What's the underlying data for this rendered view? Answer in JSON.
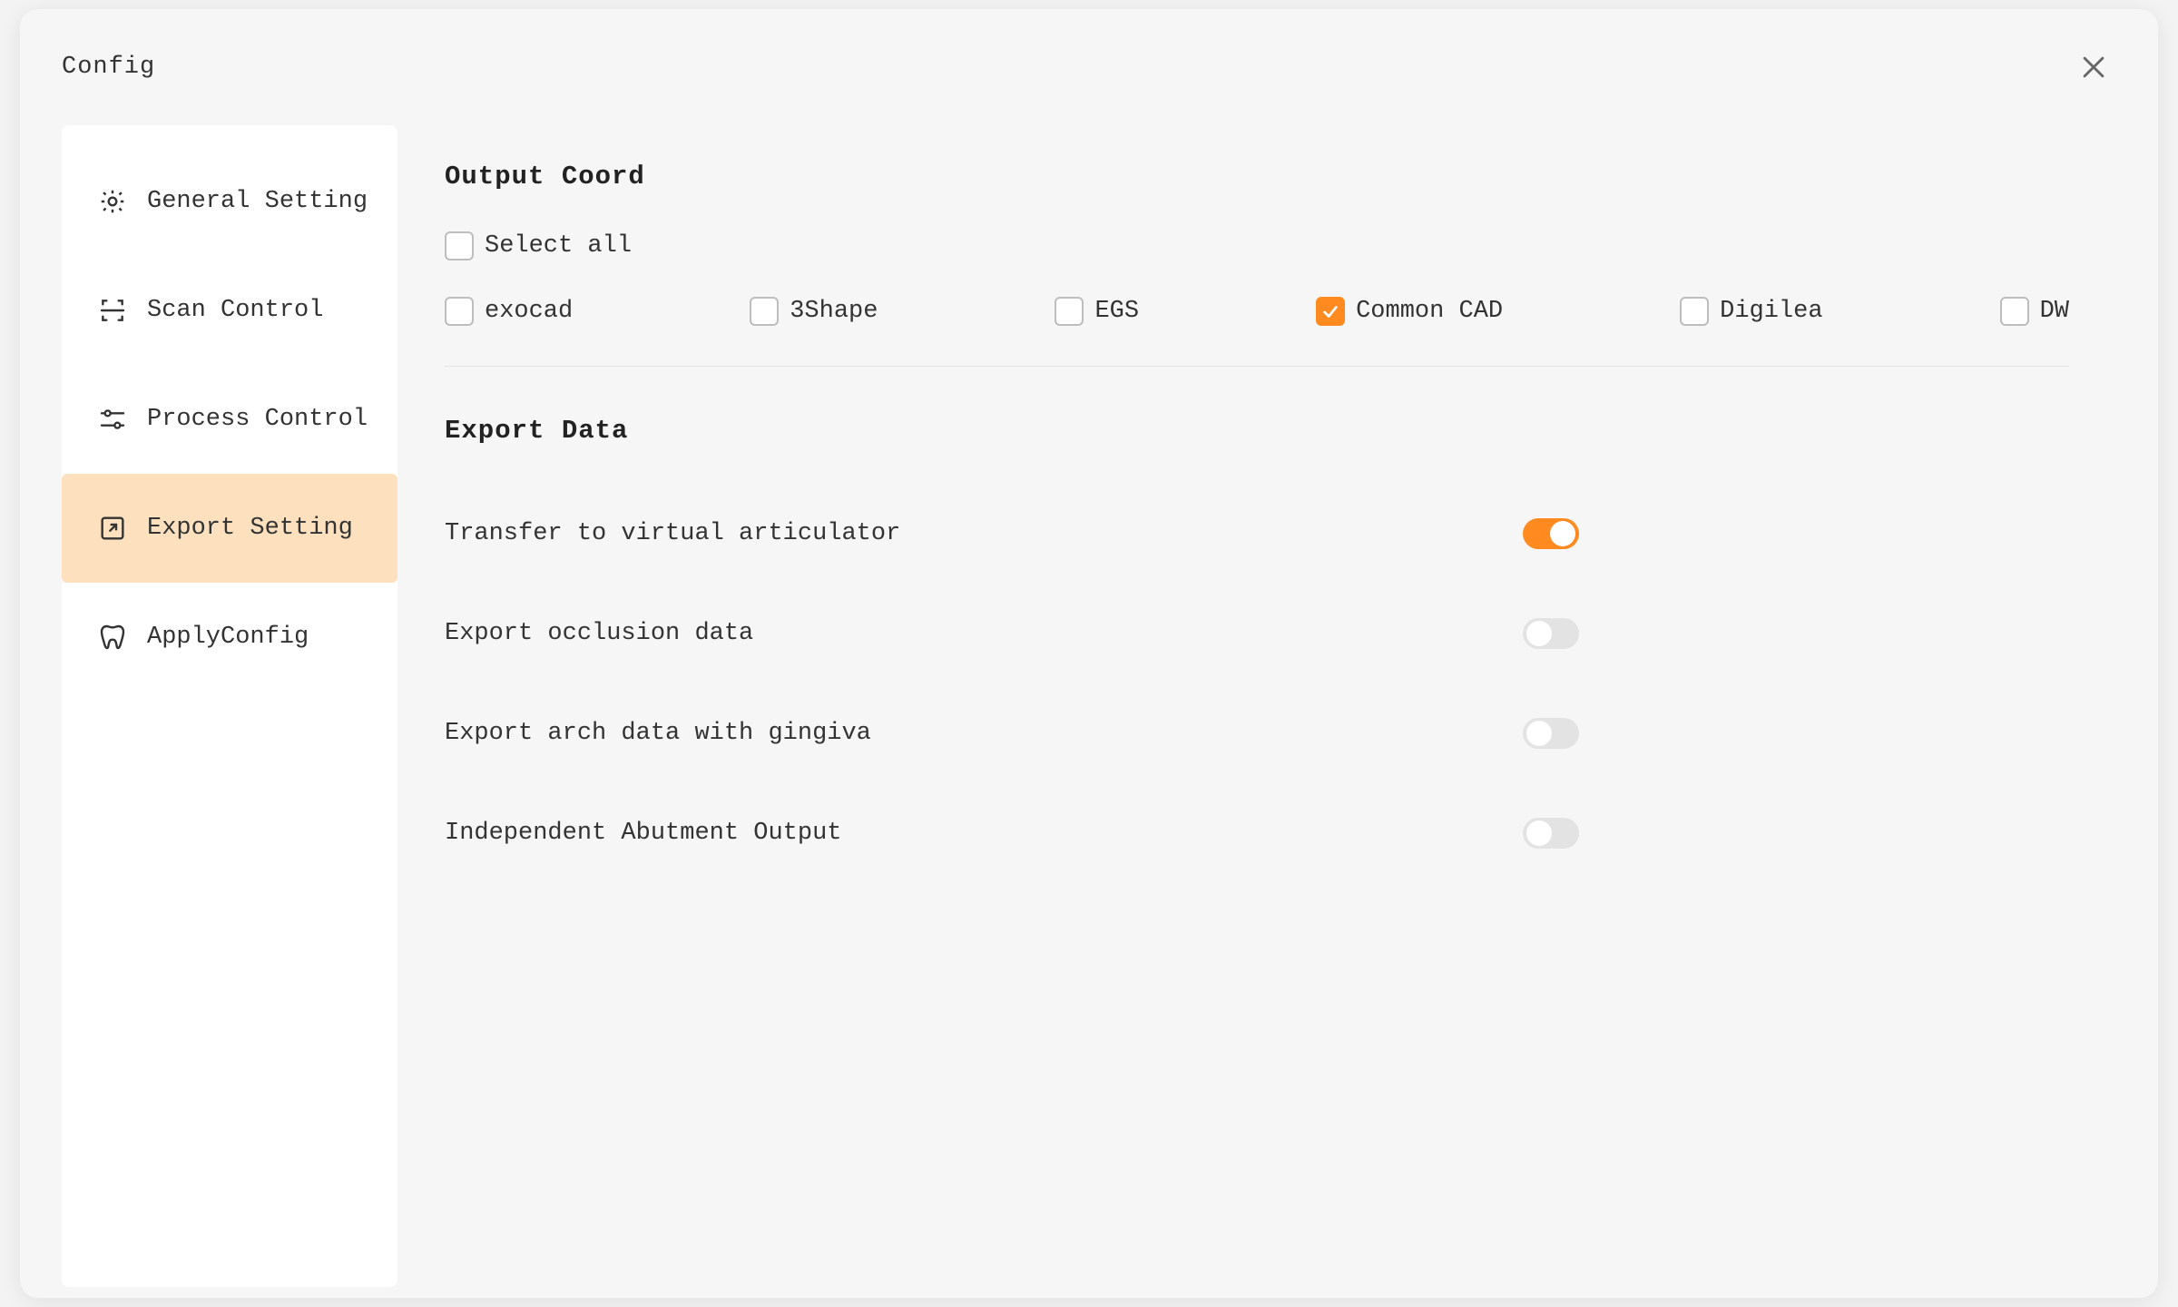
{
  "dialog": {
    "title": "Config"
  },
  "sidebar": {
    "items": [
      {
        "label": "General Setting",
        "selected": false
      },
      {
        "label": "Scan Control",
        "selected": false
      },
      {
        "label": "Process Control",
        "selected": false
      },
      {
        "label": "Export Setting",
        "selected": true
      },
      {
        "label": "ApplyConfig",
        "selected": false
      }
    ]
  },
  "main": {
    "output_coord": {
      "title": "Output Coord",
      "select_all": {
        "label": "Select all",
        "checked": false
      },
      "options": [
        {
          "label": "exocad",
          "checked": false
        },
        {
          "label": "3Shape",
          "checked": false
        },
        {
          "label": "EGS",
          "checked": false
        },
        {
          "label": "Common CAD",
          "checked": true
        },
        {
          "label": "Digilea",
          "checked": false
        },
        {
          "label": "DW",
          "checked": false
        }
      ]
    },
    "export_data": {
      "title": "Export Data",
      "toggles": [
        {
          "label": "Transfer to virtual articulator",
          "on": true
        },
        {
          "label": "Export occlusion data",
          "on": false
        },
        {
          "label": "Export arch data with gingiva",
          "on": false
        },
        {
          "label": "Independent Abutment Output",
          "on": false
        }
      ]
    }
  }
}
